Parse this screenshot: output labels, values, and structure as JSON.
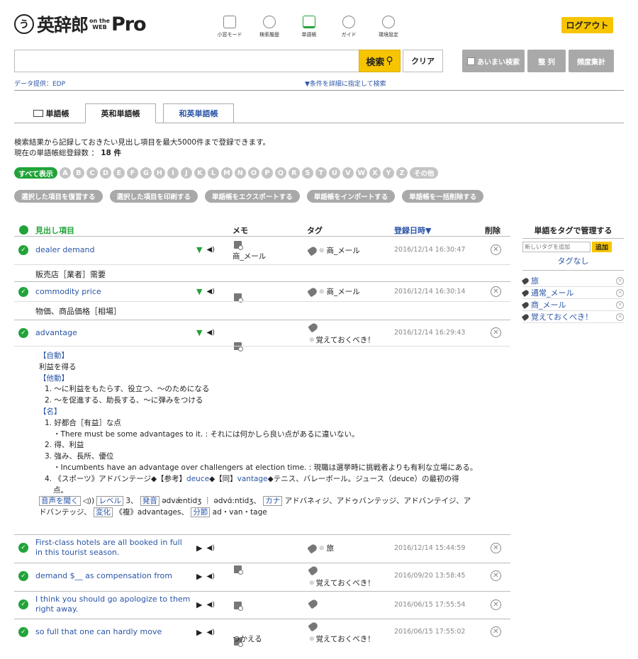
{
  "header": {
    "logo_symbol": "う",
    "logo_text": "英辞郎",
    "logo_onthe": "on the",
    "logo_web": "WEB",
    "logo_pro": "Pro",
    "icons": [
      {
        "label": "小窓モード",
        "icon": "small-window-icon"
      },
      {
        "label": "検索履歴",
        "icon": "history-icon"
      },
      {
        "label": "単語帳",
        "icon": "wordbook-icon"
      },
      {
        "label": "ガイド",
        "icon": "guide-icon"
      },
      {
        "label": "環境設定",
        "icon": "settings-icon"
      }
    ],
    "logout": "ログアウト"
  },
  "search": {
    "value": "",
    "search_label": "検索",
    "clear_label": "クリア",
    "fuzzy_label": "あいまい検索",
    "sort_label": "整 列",
    "freq_label": "頻度集計",
    "provider": "データ提供：EDP",
    "detail_link": "▼条件を詳細に指定して検索"
  },
  "tabs": {
    "wordbook": "単語帳",
    "ej": "英和単語帳",
    "je": "和英単語帳"
  },
  "info": {
    "line1": "検索結果から記録しておきたい見出し項目を最大5000件まで登録できます。",
    "line2_prefix": "現在の単語帳総登録数 ： ",
    "count": "18 件"
  },
  "alphabet": {
    "all": "すべて表示",
    "letters": [
      "A",
      "B",
      "C",
      "D",
      "E",
      "F",
      "G",
      "H",
      "I",
      "J",
      "K",
      "L",
      "M",
      "N",
      "O",
      "P",
      "Q",
      "R",
      "S",
      "T",
      "U",
      "V",
      "W",
      "X",
      "Y",
      "Z"
    ],
    "other": "その他"
  },
  "actions": [
    "選択した項目を復習する",
    "選択した項目を印刷する",
    "単語帳をエクスポートする",
    "単語帳をインポートする",
    "単語帳を一括削除する"
  ],
  "table": {
    "col_headword": "見出し項目",
    "col_memo": "メモ",
    "col_tag": "タグ",
    "col_date": "登録日時▼",
    "col_delete": "削除",
    "rows": [
      {
        "word": "dealer demand",
        "memo": "商_メール",
        "tag": "商_メール",
        "date": "2016/12/14 16:30:47",
        "meaning": "販売店［業者］需要"
      },
      {
        "word": "commodity price",
        "memo": "",
        "tag": "商_メール",
        "date": "2016/12/14 16:30:14",
        "meaning": "物価、商品価格［相場］"
      },
      {
        "word": "advantage",
        "memo": "",
        "tag": "覚えておくべき！",
        "date": "2016/12/14 16:29:43",
        "meaning": ""
      },
      {
        "word": "First-class hotels are all booked in full in this tourist season.",
        "memo": "",
        "tag": "旅",
        "date": "2016/12/14 15:44:59",
        "meaning": ""
      },
      {
        "word": "demand $__ as compensation from",
        "memo": "",
        "tag": "覚えておくべき！",
        "date": "2016/09/20 13:58:45",
        "meaning": ""
      },
      {
        "word": "I think you should go apologize to them right away.",
        "memo": "",
        "tag": "",
        "date": "2016/06/15 17:55:54",
        "meaning": ""
      },
      {
        "word": "so full that one can hardly move",
        "memo": "つかえる",
        "tag": "覚えておくべき！",
        "date": "2016/06/15 17:55:02",
        "meaning": ""
      }
    ]
  },
  "advantage_detail": {
    "l1": "【自動】",
    "l2": "利益を得る",
    "l3": "【他動】",
    "l4": "1. ～に利益をもたらす、役立つ、～のためになる",
    "l5": "2. ～を促進する、助長する、～に弾みをつける",
    "l6": "【名】",
    "l7": "1. 好都合［有益］な点",
    "l8": "・There must be some advantages to it. : それには何かしら良い点があるに違いない。",
    "l9": "2. 得、利益",
    "l10": "3. 強み、長所、優位",
    "l11": "・Incumbents have an advantage over challengers at election time. : 現職は選挙時に挑戦者よりも有利な立場にある。",
    "l12a": "4. 《スポーツ》アドバンテージ◆【参考】",
    "l12b": "deuce",
    "l12c": "◆【同】",
    "l12d": "vantage",
    "l12e": "◆テニス、バレーボール。ジュース（deuce）の最初の得",
    "l13": "点。",
    "audio_label": "音声を聞く",
    "level_label": "レベル",
    "level_value": "3、",
    "pron_label": "発音",
    "pron_value": "ədvǽntidʒ ｜ ədvɑ́:ntidʒ、",
    "kana_label": "カナ",
    "kana_value": "アドバネィジ、アドゥバンテッジ、アドバンテイジ、ア",
    "kana_value2": "ドバンテッジ、",
    "change_label": "変化",
    "change_value": "《複》advantages、",
    "split_label": "分節",
    "split_value": "ad・van・tage"
  },
  "side": {
    "title": "単語をタグで管理する",
    "input_placeholder": "新しいタグを追加",
    "add_label": "追加",
    "notag": "タグなし",
    "tags": [
      "旅",
      "通常_メール",
      "商_メール",
      "覚えておくべき！"
    ]
  },
  "colors": {
    "accent_green": "#22a33a",
    "brand_yellow": "#f7c500",
    "link_blue": "#2a55a7"
  }
}
